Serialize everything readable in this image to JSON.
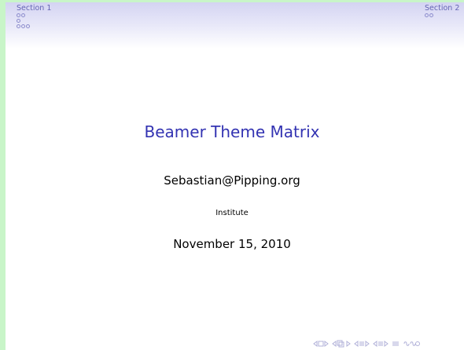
{
  "header": {
    "section_left": "Section 1",
    "section_right": "Section 2"
  },
  "title_page": {
    "title": "Beamer Theme Matrix",
    "author": "Sebastian@Pipping.org",
    "institute": "Institute",
    "date": "November 15, 2010"
  },
  "colors": {
    "sidebar": "#c8f5c8",
    "header_gradient": "#d4d4f2",
    "title": "#3333b2",
    "nav": "#b0b0d8"
  },
  "nav_icons": [
    "slide-left-icon",
    "slide-icon",
    "slide-right-icon",
    "frame-left-icon",
    "frame-icon",
    "frame-right-icon",
    "section-left-icon",
    "section-icon",
    "section-right-icon",
    "subsection-left-icon",
    "subsection-icon",
    "subsection-right-icon",
    "align-icon",
    "search-icon"
  ]
}
